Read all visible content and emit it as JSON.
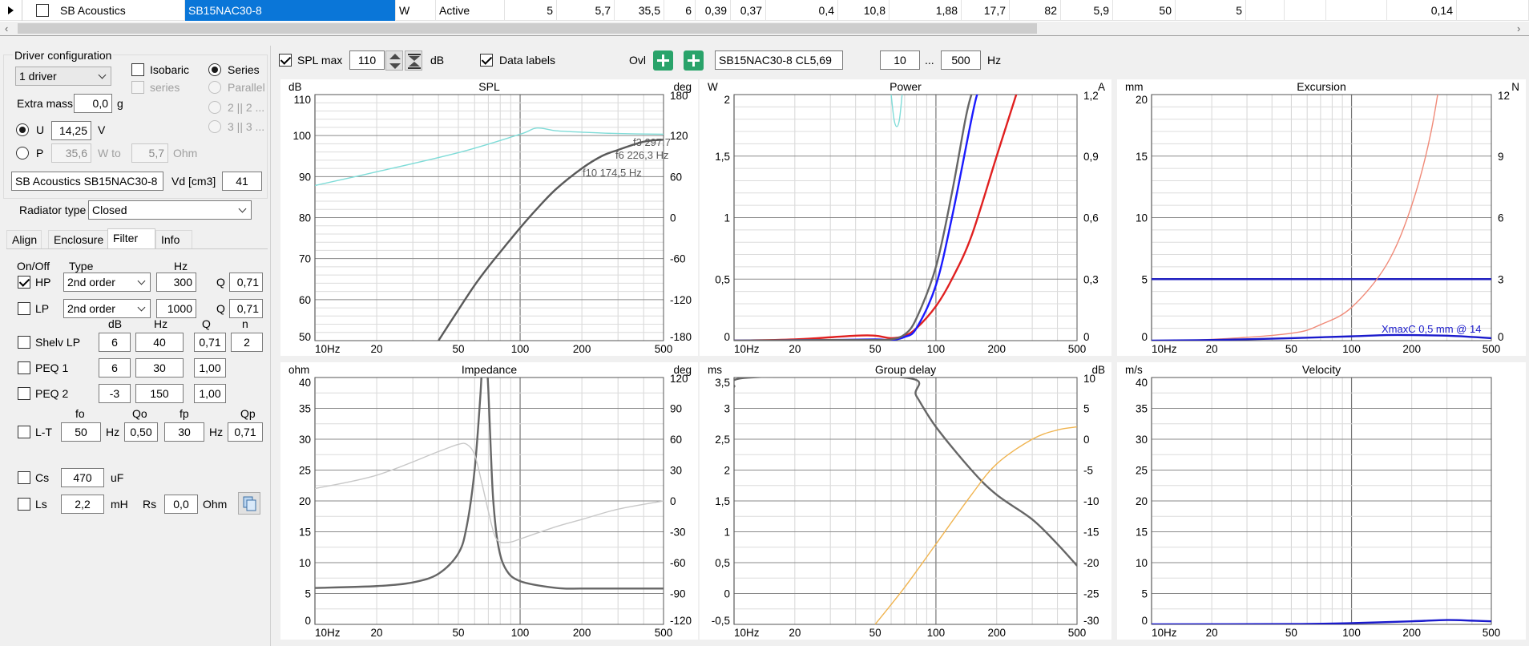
{
  "table_row": {
    "cells": [
      "SB Acoustics",
      "SB15NAC30-8",
      "W",
      "Active",
      "5",
      "5,7",
      "35,5",
      "6",
      "0,39",
      "0,37",
      "0,4",
      "10,8",
      "1,88",
      "17,7",
      "82",
      "5,9",
      "50",
      "5",
      "",
      "",
      "",
      "0,14",
      ""
    ],
    "checked": false
  },
  "scroll": {
    "left_arrow": "‹",
    "right_arrow": "›"
  },
  "left": {
    "driver_config_title": "Driver configuration",
    "driver_count": "1 driver",
    "isobaric": {
      "label": "Isobaric",
      "checked": false
    },
    "series_cb": {
      "label": "series",
      "checked": false
    },
    "wiring": [
      {
        "label": "Series",
        "selected": true
      },
      {
        "label": "Parallel",
        "selected": false
      },
      {
        "label": "2 || 2 ...",
        "selected": false
      },
      {
        "label": "3 || 3 ...",
        "selected": false
      }
    ],
    "extra_mass": {
      "label": "Extra mass",
      "value": "0,0",
      "unit": "g"
    },
    "u": {
      "label": "U",
      "value": "14,25",
      "unit": "V",
      "selected": true
    },
    "p": {
      "label": "P",
      "value": "35,6",
      "unit": "W to",
      "ohm_value": "5,7",
      "ohm_unit": "Ohm",
      "selected": false
    },
    "driver_name": "SB Acoustics SB15NAC30-8",
    "vd": {
      "label": "Vd [cm3]",
      "value": "41"
    },
    "radiator_type": {
      "label": "Radiator type",
      "value": "Closed"
    },
    "tabs": [
      "Align",
      "Enclosure",
      "Filter",
      "Info"
    ],
    "active_tab": "Filter",
    "filter": {
      "hdr_onoff": "On/Off",
      "hdr_type": "Type",
      "hdr_hz": "Hz",
      "hp": {
        "label": "HP",
        "checked": true,
        "type": "2nd order",
        "hz": "300",
        "q_label": "Q",
        "q": "0,71"
      },
      "lp": {
        "label": "LP",
        "checked": false,
        "type": "2nd order",
        "hz": "1000",
        "q_label": "Q",
        "q": "0,71"
      },
      "hdr_db": "dB",
      "hdr_hz2": "Hz",
      "hdr_q": "Q",
      "hdr_n": "n",
      "shelv": {
        "label": "Shelv LP",
        "checked": false,
        "db": "6",
        "hz": "40",
        "q": "0,71",
        "n": "2"
      },
      "peq1": {
        "label": "PEQ 1",
        "checked": false,
        "db": "6",
        "hz": "30",
        "q": "1,00"
      },
      "peq2": {
        "label": "PEQ 2",
        "checked": false,
        "db": "-3",
        "hz": "150",
        "q": "1,00"
      },
      "hdr_fo": "fo",
      "hdr_qo": "Qo",
      "hdr_fp": "fp",
      "hdr_qp": "Qp",
      "lt": {
        "label": "L-T",
        "checked": false,
        "fo": "50",
        "hz_unit": "Hz",
        "qo": "0,50",
        "fp": "30",
        "hz_unit2": "Hz",
        "qp": "0,71"
      },
      "cs": {
        "label": "Cs",
        "checked": false,
        "value": "470",
        "unit": "uF"
      },
      "ls": {
        "label": "Ls",
        "checked": false,
        "value": "2,2",
        "unit": "mH",
        "rs_label": "Rs",
        "rs": "0,0",
        "rs_unit": "Ohm"
      }
    }
  },
  "toolbar": {
    "spl_max": {
      "label": "SPL max",
      "checked": true,
      "value": "110",
      "unit": "dB"
    },
    "data_labels": {
      "label": "Data labels",
      "checked": true
    },
    "ovl": "Ovl",
    "overlay_name": "SB15NAC30-8 CL5,69",
    "f_from": "10",
    "range_sep": "...",
    "f_to": "500",
    "f_unit": "Hz"
  },
  "chart_data": [
    {
      "id": "spl",
      "type": "line",
      "title": "SPL",
      "left_unit": "dB",
      "right_unit": "deg",
      "xlim": [
        10,
        500
      ],
      "xscale": "log",
      "x_ticks": [
        "10Hz",
        "20",
        "50",
        "100",
        "200",
        "500"
      ],
      "ylim": [
        50,
        110
      ],
      "y_ticks": [
        "110",
        "100",
        "90",
        "80",
        "70",
        "60",
        "50"
      ],
      "y2lim": [
        -180,
        180
      ],
      "y2_ticks": [
        "180",
        "120",
        "60",
        "0",
        "-60",
        "-120",
        "-180"
      ],
      "annotations": [
        "f3 297,7",
        "f6 226,3 Hz",
        "f10 174,5 Hz"
      ],
      "series": [
        {
          "color": "#595959",
          "axis": "y",
          "x": [
            40,
            50,
            60,
            70,
            80,
            100,
            120,
            150,
            200,
            250,
            300,
            400,
            500
          ],
          "y": [
            50,
            57.5,
            63.5,
            68,
            71.6,
            77.5,
            82,
            87,
            92,
            95,
            96.5,
            98.5,
            99
          ]
        },
        {
          "color": "#7fdcd8",
          "axis": "y2",
          "x": [
            10,
            20,
            50,
            100,
            120,
            150,
            200,
            300,
            500
          ],
          "y": [
            47,
            67,
            95,
            122,
            131,
            127,
            125,
            123,
            122
          ]
        }
      ]
    },
    {
      "id": "power",
      "type": "line",
      "title": "Power",
      "left_unit": "W",
      "right_unit": "A",
      "xlim": [
        10,
        500
      ],
      "xscale": "log",
      "x_ticks": [
        "10Hz",
        "20",
        "50",
        "100",
        "200",
        "500"
      ],
      "ylim": [
        0,
        2
      ],
      "y_ticks": [
        "2",
        "1,5",
        "1",
        "0,5",
        "0"
      ],
      "y2lim": [
        0,
        1.2
      ],
      "y2_ticks": [
        "1,2",
        "0,9",
        "0,6",
        "0,3",
        "0"
      ],
      "series": [
        {
          "color": "#e02020",
          "axis": "y",
          "x": [
            10,
            20,
            40,
            50,
            60,
            70,
            80,
            100,
            120,
            150,
            200,
            250
          ],
          "y": [
            0,
            0.01,
            0.04,
            0.04,
            0.02,
            0.04,
            0.1,
            0.28,
            0.5,
            0.85,
            1.5,
            2
          ]
        },
        {
          "color": "#1a1aff",
          "axis": "y",
          "x": [
            10,
            30,
            50,
            60,
            70,
            80,
            100,
            120,
            150,
            160,
            170
          ],
          "y": [
            0,
            0.005,
            0.01,
            0.005,
            0.03,
            0.1,
            0.45,
            1.0,
            1.8,
            2,
            2.1
          ]
        },
        {
          "color": "#666666",
          "axis": "y",
          "x": [
            10,
            30,
            50,
            60,
            70,
            80,
            100,
            120,
            140,
            150,
            160
          ],
          "y": [
            0,
            0.005,
            0.005,
            0.01,
            0.05,
            0.18,
            0.6,
            1.2,
            1.8,
            2,
            2.1
          ]
        },
        {
          "color": "#7fdcd8",
          "axis": "y",
          "x": [
            60,
            62,
            64,
            66,
            68
          ],
          "y": [
            2,
            1.8,
            1.74,
            1.8,
            2
          ]
        }
      ]
    },
    {
      "id": "excursion",
      "type": "line",
      "title": "Excursion",
      "left_unit": "mm",
      "right_unit": "N",
      "xlim": [
        10,
        500
      ],
      "xscale": "log",
      "x_ticks": [
        "10Hz",
        "20",
        "50",
        "100",
        "200",
        "500"
      ],
      "ylim": [
        0,
        20
      ],
      "y_ticks": [
        "20",
        "15",
        "10",
        "5",
        "0"
      ],
      "y2lim": [
        0,
        12
      ],
      "y2_ticks": [
        "12",
        "9",
        "6",
        "3",
        "0"
      ],
      "annotations": [
        "XmaxC 0,5 mm  @ 14"
      ],
      "series": [
        {
          "color": "#2020c0",
          "axis": "y",
          "x": [
            10,
            500
          ],
          "y": [
            5,
            5
          ]
        },
        {
          "color": "#f08a78",
          "axis": "y",
          "x": [
            10,
            20,
            50,
            70,
            100,
            150,
            200,
            250,
            300,
            350,
            400
          ],
          "y": [
            0,
            0.1,
            0.6,
            1.3,
            2.7,
            6.2,
            11,
            17,
            25,
            33,
            42
          ]
        },
        {
          "color": "#1a1acc",
          "axis": "y",
          "x": [
            10,
            20,
            50,
            100,
            150,
            200,
            300,
            400,
            500
          ],
          "y": [
            0,
            0.05,
            0.2,
            0.35,
            0.45,
            0.45,
            0.4,
            0.3,
            0.2
          ]
        }
      ]
    },
    {
      "id": "impedance",
      "type": "line",
      "title": "Impedance",
      "left_unit": "ohm",
      "right_unit": "deg",
      "xlim": [
        10,
        500
      ],
      "xscale": "log",
      "x_ticks": [
        "10Hz",
        "20",
        "50",
        "100",
        "200",
        "500"
      ],
      "ylim": [
        0,
        40
      ],
      "y_ticks": [
        "40",
        "35",
        "30",
        "25",
        "20",
        "15",
        "10",
        "5",
        "0"
      ],
      "y2lim": [
        -120,
        120
      ],
      "y2_ticks": [
        "120",
        "90",
        "60",
        "30",
        "0",
        "-30",
        "-60",
        "-90",
        "-120"
      ],
      "series": [
        {
          "color": "#666666",
          "axis": "y",
          "x": [
            10,
            20,
            30,
            40,
            50,
            55,
            60,
            64,
            66,
            68,
            70,
            72,
            74,
            78,
            85,
            100,
            150,
            200,
            300,
            500
          ],
          "y": [
            5.9,
            6.2,
            6.8,
            8.2,
            11.5,
            16,
            25,
            37,
            45,
            45,
            38,
            28,
            20,
            13,
            9,
            7,
            5.9,
            5.8,
            5.8,
            5.8
          ]
        },
        {
          "color": "#c8c8c8",
          "axis": "y2",
          "x": [
            10,
            20,
            40,
            50,
            55,
            60,
            65,
            70,
            75,
            80,
            90,
            100,
            150,
            200,
            300,
            500
          ],
          "y": [
            12,
            25,
            48,
            55,
            55,
            45,
            18,
            -10,
            -33,
            -40,
            -40,
            -37,
            -25,
            -18,
            -8,
            0
          ]
        }
      ]
    },
    {
      "id": "group_delay",
      "type": "line",
      "title": "Group delay",
      "left_unit": "ms",
      "right_unit": "dB",
      "xlim": [
        10,
        500
      ],
      "xscale": "log",
      "x_ticks": [
        "10Hz",
        "20",
        "50",
        "100",
        "200",
        "500"
      ],
      "ylim": [
        -0.5,
        3.5
      ],
      "y_ticks": [
        "3,5",
        "3",
        "2,5",
        "2",
        "1,5",
        "1",
        "0,5",
        "0",
        "-0,5"
      ],
      "y2lim": [
        -30,
        10
      ],
      "y2_ticks": [
        "10",
        "5",
        "0",
        "-5",
        "-10",
        "-15",
        "-20",
        "-25",
        "-30"
      ],
      "series": [
        {
          "color": "#666666",
          "axis": "y",
          "x": [
            10,
            12,
            70,
            80,
            100,
            150,
            200,
            300,
            400,
            500
          ],
          "y": [
            3.35,
            3.5,
            3.5,
            3.2,
            2.7,
            2.0,
            1.6,
            1.2,
            0.8,
            0.45
          ]
        },
        {
          "color": "#f0b450",
          "axis": "y2",
          "x": [
            50,
            70,
            100,
            150,
            200,
            300,
            400,
            500
          ],
          "y": [
            -30,
            -24,
            -17,
            -9,
            -4,
            0,
            1.5,
            2
          ]
        }
      ]
    },
    {
      "id": "velocity",
      "type": "line",
      "title": "Velocity",
      "left_unit": "m/s",
      "right_unit": "",
      "xlim": [
        10,
        500
      ],
      "xscale": "log",
      "x_ticks": [
        "10Hz",
        "20",
        "50",
        "100",
        "200",
        "500"
      ],
      "ylim": [
        0,
        40
      ],
      "y_ticks": [
        "40",
        "35",
        "30",
        "25",
        "20",
        "15",
        "10",
        "5",
        "0"
      ],
      "series": [
        {
          "color": "#1a1acc",
          "axis": "y",
          "x": [
            10,
            50,
            100,
            200,
            300,
            400,
            500
          ],
          "y": [
            0,
            0.05,
            0.2,
            0.5,
            0.7,
            0.6,
            0.5
          ]
        }
      ]
    }
  ]
}
